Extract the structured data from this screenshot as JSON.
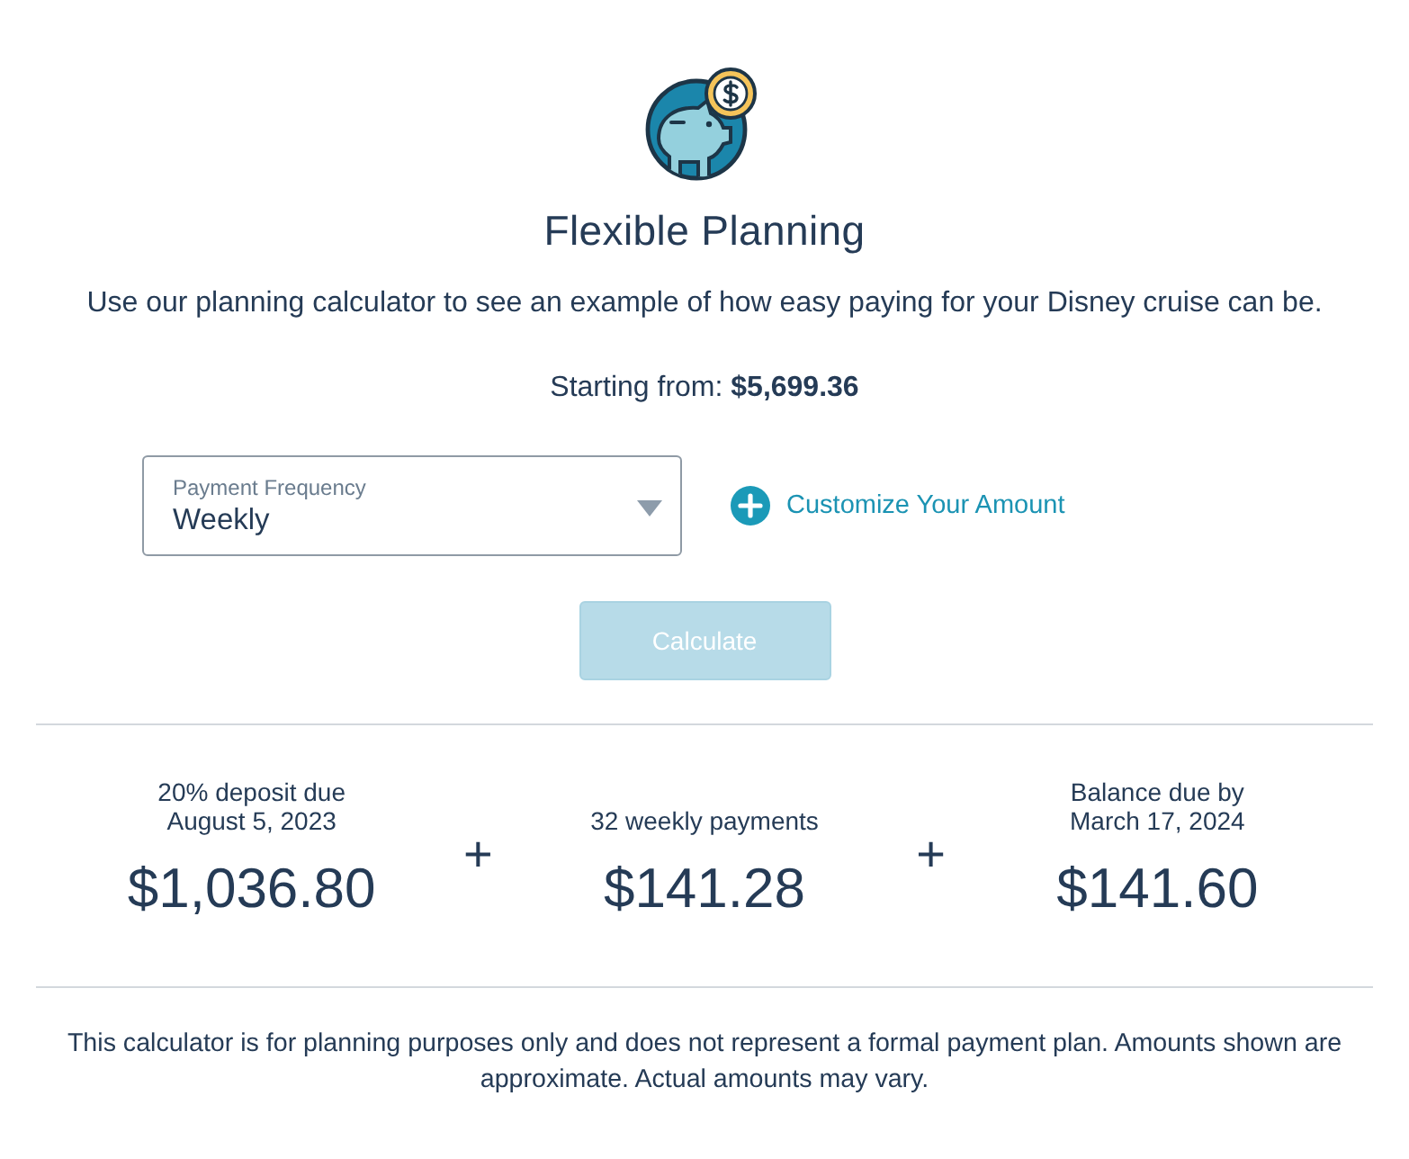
{
  "header": {
    "title": "Flexible Planning",
    "subtitle": "Use our planning calculator to see an example of how easy paying for your Disney cruise can be.",
    "starting_from": "Starting from: **$5,699.36**"
  },
  "form": {
    "payment_frequency": {
      "label": "Payment Frequency",
      "value": "Weekly"
    },
    "customize_link": "Customize Your Amount",
    "calculate_button": {
      "label": "Calculate",
      "disabled": true
    }
  },
  "results": [
    {
      "lines": [
        "20% deposit due",
        "August 5, 2023"
      ],
      "amount": "$1,036.80"
    },
    {
      "lines": [
        "32 weekly payments"
      ],
      "amount": "$141.28"
    },
    {
      "lines": [
        "Balance due by",
        "March 17, 2024"
      ],
      "amount": "$141.60"
    }
  ],
  "operators": [
    "+",
    "+"
  ],
  "disclaimer": "This calculator is for planning purposes only and does not represent a formal payment plan. Amounts shown are approximate. Actual amounts may vary."
}
